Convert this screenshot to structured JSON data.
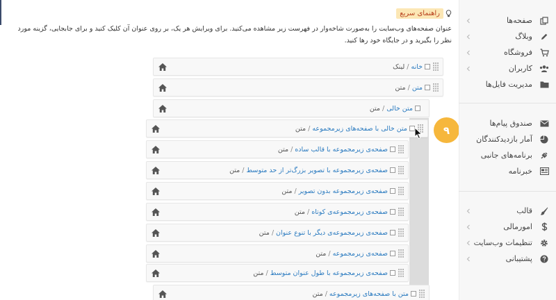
{
  "quick_help": {
    "title": "راهنمای سریع",
    "description": "عنوان صفحه‌های وب‌سایت را به‌صورت شاخه‌وار در فهرست زیر مشاهده می‌کنید. برای ویرایش هر یک، بر روی عنوان آن کلیک کنید و برای جابجایی، گزینه مورد نظر را بگیرید و در جایگاه خود رها کنید."
  },
  "sidebar": {
    "group1": [
      {
        "label": "صفحه‌ها",
        "icon": "pages-icon",
        "chevron": true
      },
      {
        "label": "وبلاگ",
        "icon": "pencil-icon",
        "chevron": true
      },
      {
        "label": "فروشگاه",
        "icon": "cart-icon",
        "chevron": true
      },
      {
        "label": "کاربران",
        "icon": "users-icon",
        "chevron": true
      },
      {
        "label": "مدیریت فایل‌ها",
        "icon": "folder-icon",
        "chevron": false
      }
    ],
    "group2": [
      {
        "label": "صندوق پیام‌ها",
        "icon": "envelope-icon",
        "chevron": false
      },
      {
        "label": "آمار بازدیدکنندگان",
        "icon": "pie-chart-icon",
        "chevron": false
      },
      {
        "label": "برنامه‌های جانبی",
        "icon": "plug-icon",
        "chevron": false
      },
      {
        "label": "خبرنامه",
        "icon": "newspaper-icon",
        "chevron": false
      }
    ],
    "group3": [
      {
        "label": "قالب",
        "icon": "brush-icon",
        "chevron": true
      },
      {
        "label": "امورمالی",
        "icon": "dollar-icon",
        "chevron": true
      },
      {
        "label": "تنظیمات وب‌سایت",
        "icon": "gear-icon",
        "chevron": true
      },
      {
        "label": "پشتیبانی",
        "icon": "question-icon",
        "chevron": true
      }
    ]
  },
  "page_tree": [
    {
      "title": "خانه",
      "type": "لینک"
    },
    {
      "title": "متن",
      "type": "متن"
    },
    {
      "title": "متن خالی",
      "type": "متن"
    },
    {
      "title": "متن خالی با صفحه‌های زیرمجموعه",
      "type": "متن"
    },
    {
      "title": "صفحه‌ی زیرمجموعه با قالب ساده",
      "type": "متن"
    },
    {
      "title": "صفحه‌ی زیرمجموعه با تصویر بزرگ‌تر از حد متوسط",
      "type": "متن"
    },
    {
      "title": "صفحه‌ی زیرمجموعه بدون تصویر",
      "type": "متن"
    },
    {
      "title": "صفحه‌ی زیرمجموعه‌ی کوتاه",
      "type": "متن"
    },
    {
      "title": "صفحه‌ی زیرمجموعه‌ی دیگر با تنوع عنوان",
      "type": "متن"
    },
    {
      "title": "صفحه‌ی زیرمجموعه",
      "type": "متن"
    },
    {
      "title": "صفحه‌ی زیرمجموعه با طول عنوان متوسط",
      "type": "متن"
    },
    {
      "title": "متن با صفحه‌های زیرمجموعه",
      "type": "متن"
    }
  ],
  "step_badge": "۹",
  "colors": {
    "accent": "#f6b73c",
    "link": "#2b7bc0",
    "help_label_bg": "#fce7b5"
  }
}
